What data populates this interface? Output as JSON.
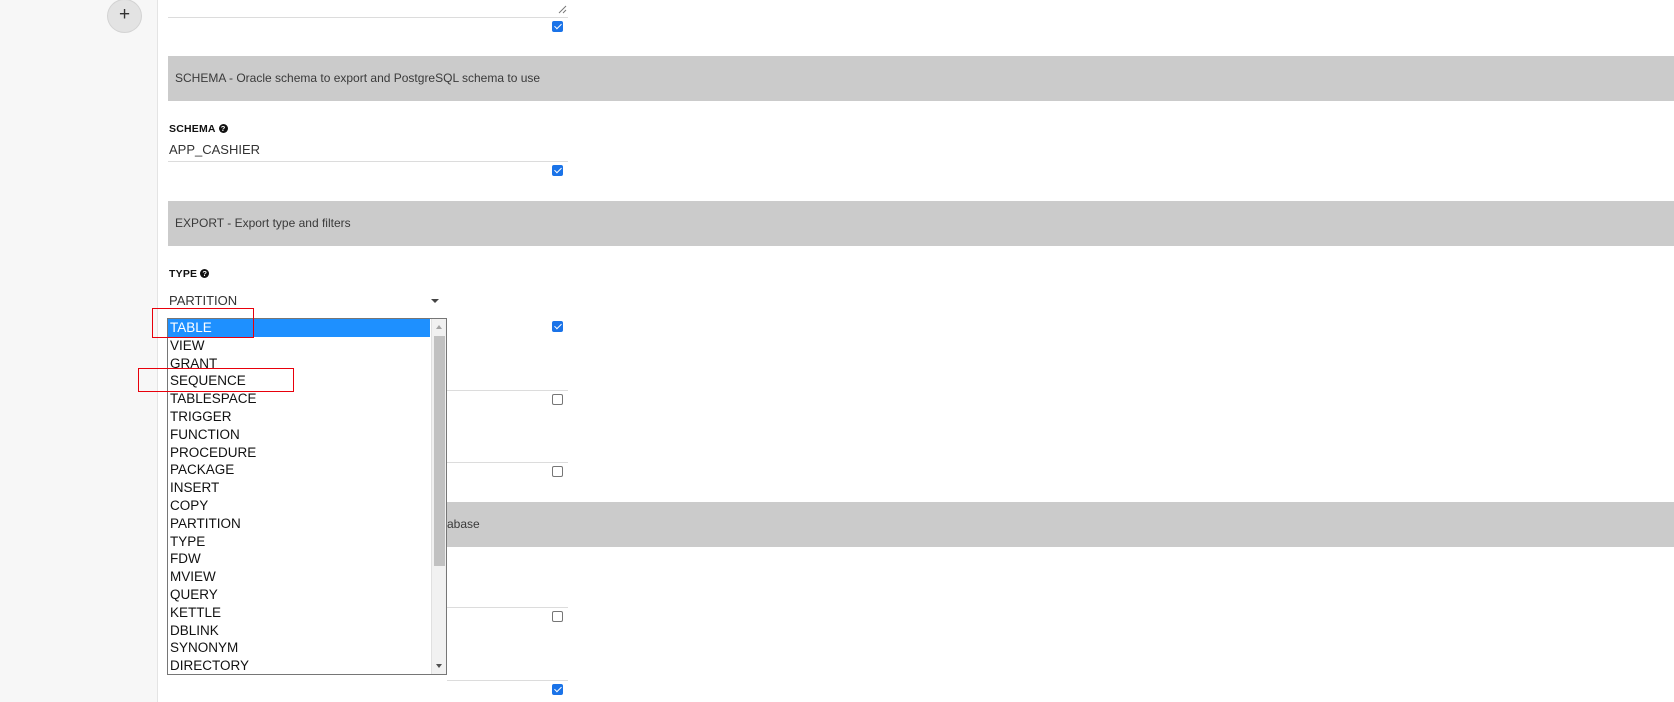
{
  "toolbar": {
    "add_label": "+"
  },
  "sections": {
    "schema": {
      "title": "SCHEMA - Oracle schema to export and PostgreSQL schema to use"
    },
    "export": {
      "title": "EXPORT - Export type and filters"
    },
    "hidden": {
      "partial_title": "abase"
    }
  },
  "fields": {
    "schema": {
      "label": "SCHEMA",
      "help": "?",
      "value": "APP_CASHIER"
    },
    "type": {
      "label": "TYPE",
      "help": "?",
      "value": "PARTITION"
    }
  },
  "dropdown": {
    "selected_index": 0,
    "options": [
      "TABLE",
      "VIEW",
      "GRANT",
      "SEQUENCE",
      "TABLESPACE",
      "TRIGGER",
      "FUNCTION",
      "PROCEDURE",
      "PACKAGE",
      "INSERT",
      "COPY",
      "PARTITION",
      "TYPE",
      "FDW",
      "MVIEW",
      "QUERY",
      "KETTLE",
      "DBLINK",
      "SYNONYM",
      "DIRECTORY"
    ]
  },
  "annotations": {
    "color": "#e8000b",
    "highlighted": [
      "TABLE",
      "SEQUENCE"
    ]
  }
}
